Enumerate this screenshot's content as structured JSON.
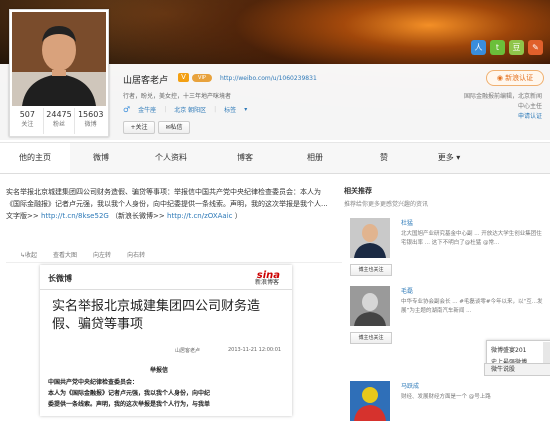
{
  "profile": {
    "name": "山居客老卢",
    "v_badge": "V",
    "vip_badge": "VIP",
    "url": "http://weibo.com/u/1060239831",
    "bio": "行者，盼兑，美女控，十三年地产咪境者",
    "location_label": "金牛座",
    "city": "北京 朝阳区",
    "tag_label": "标签",
    "follow_label": "关注",
    "message_label": "私信",
    "stats": [
      {
        "num": "507",
        "label": "关注"
      },
      {
        "num": "24475",
        "label": "粉丝"
      },
      {
        "num": "15603",
        "label": "微博"
      }
    ]
  },
  "verify": {
    "label": "新浪认证",
    "line1": "国际金融报前编辑，北京新闻",
    "line2": "中心主任",
    "apply": "申请认证"
  },
  "social_icons": [
    {
      "name": "renren",
      "glyph": "人",
      "color": "#3a8ddb"
    },
    {
      "name": "twitter",
      "glyph": "t",
      "color": "#6bbf3a"
    },
    {
      "name": "douban",
      "glyph": "豆",
      "color": "#8fc54a"
    },
    {
      "name": "blog",
      "glyph": "✎",
      "color": "#e0602b"
    }
  ],
  "nav": [
    "他的主页",
    "微博",
    "个人资料",
    "博客",
    "相册",
    "赞",
    "更多 ▾"
  ],
  "post": {
    "text_part1": "实名举报北京城建集团四公司财务造假、骗贷等事项：举报信中国共产党中央纪律检查委员会：本人为《国际金融报》记者卢元强，我以我个人身份，向中纪委提供一条线索。声明，我的这次举报是我个人...文字版>>",
    "link1": "http://t.cn/8kse52G",
    "text_part2": "（新浪长微博>>",
    "link2": "http://t.cn/zOXAaic",
    "text_part3": "）",
    "actions": [
      "↳收起",
      "查看大图",
      "向左转",
      "向右转"
    ]
  },
  "document": {
    "brand": "长微博",
    "sina_logo": "sina",
    "sina_sub": "新浪博客",
    "title": "实名举报北京城建集团四公司财务造假、骗贷等事项",
    "author": "山居客老卢",
    "date": "2013-11-21 12:00:01",
    "letter_heading": "举报信",
    "body_lines": [
      "中国共产党中央纪律检查委员会：",
      "本人为《国际金融报》记者卢元强，我以我个人身份，向中纪",
      "委提供一条线索。声明，我的这次举报是我个人行为，与我单"
    ]
  },
  "sidebar": {
    "title": "相关推荐",
    "subtitle": "推荐给你更多更感觉兴趣的资讯",
    "recs": [
      {
        "name": "杜猛",
        "desc": "北大国旭产业研究基金中心副 ... 开放达大学生创业集团住宅银出率 ... 这下不明白了@杜猛 @常...",
        "follow": "博主也关注"
      },
      {
        "name": "毛磊",
        "desc": "中华专业协会副会长 ... #毛磊谈零#今年以来，以“互...发展”为主题的湖南汽车新闻 ...",
        "follow": "博主也关注"
      },
      {
        "name": "马跃成",
        "desc": "财经、发展财经方面是一个 @号上路",
        "follow": "博主也关注"
      }
    ]
  },
  "popup": {
    "line1": "微博盛宴201",
    "line2": "史上最强微博",
    "tab": "微牛说股"
  }
}
